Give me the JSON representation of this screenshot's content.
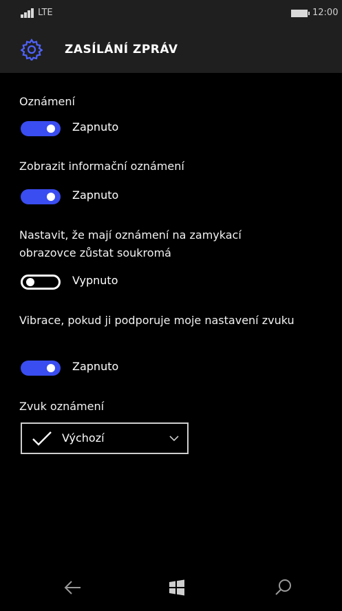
{
  "status": {
    "network": "LTE",
    "time": "12:00"
  },
  "header": {
    "title": "ZASÍLÁNÍ ZPRÁV"
  },
  "settings": [
    {
      "label": "Oznámení",
      "state": "Zapnuto",
      "on": true
    },
    {
      "label": "Zobrazit informační oznámení",
      "state": "Zapnuto",
      "on": true
    },
    {
      "label": "Nastavit, že mají oznámení na zamykací obrazovce zůstat soukromá",
      "state": "Vypnuto",
      "on": false
    },
    {
      "label": "Vibrace, pokud ji podporuje moje nastavení zvuku",
      "state": "Zapnuto",
      "on": true
    }
  ],
  "sound": {
    "label": "Zvuk oznámení",
    "selected": "Výchozí"
  },
  "colors": {
    "accent": "#3a4df0",
    "header_bg": "#1f1f1f",
    "bg": "#000000"
  },
  "nav": {
    "icons": [
      "back-arrow-icon",
      "windows-logo-icon",
      "search-icon"
    ]
  }
}
